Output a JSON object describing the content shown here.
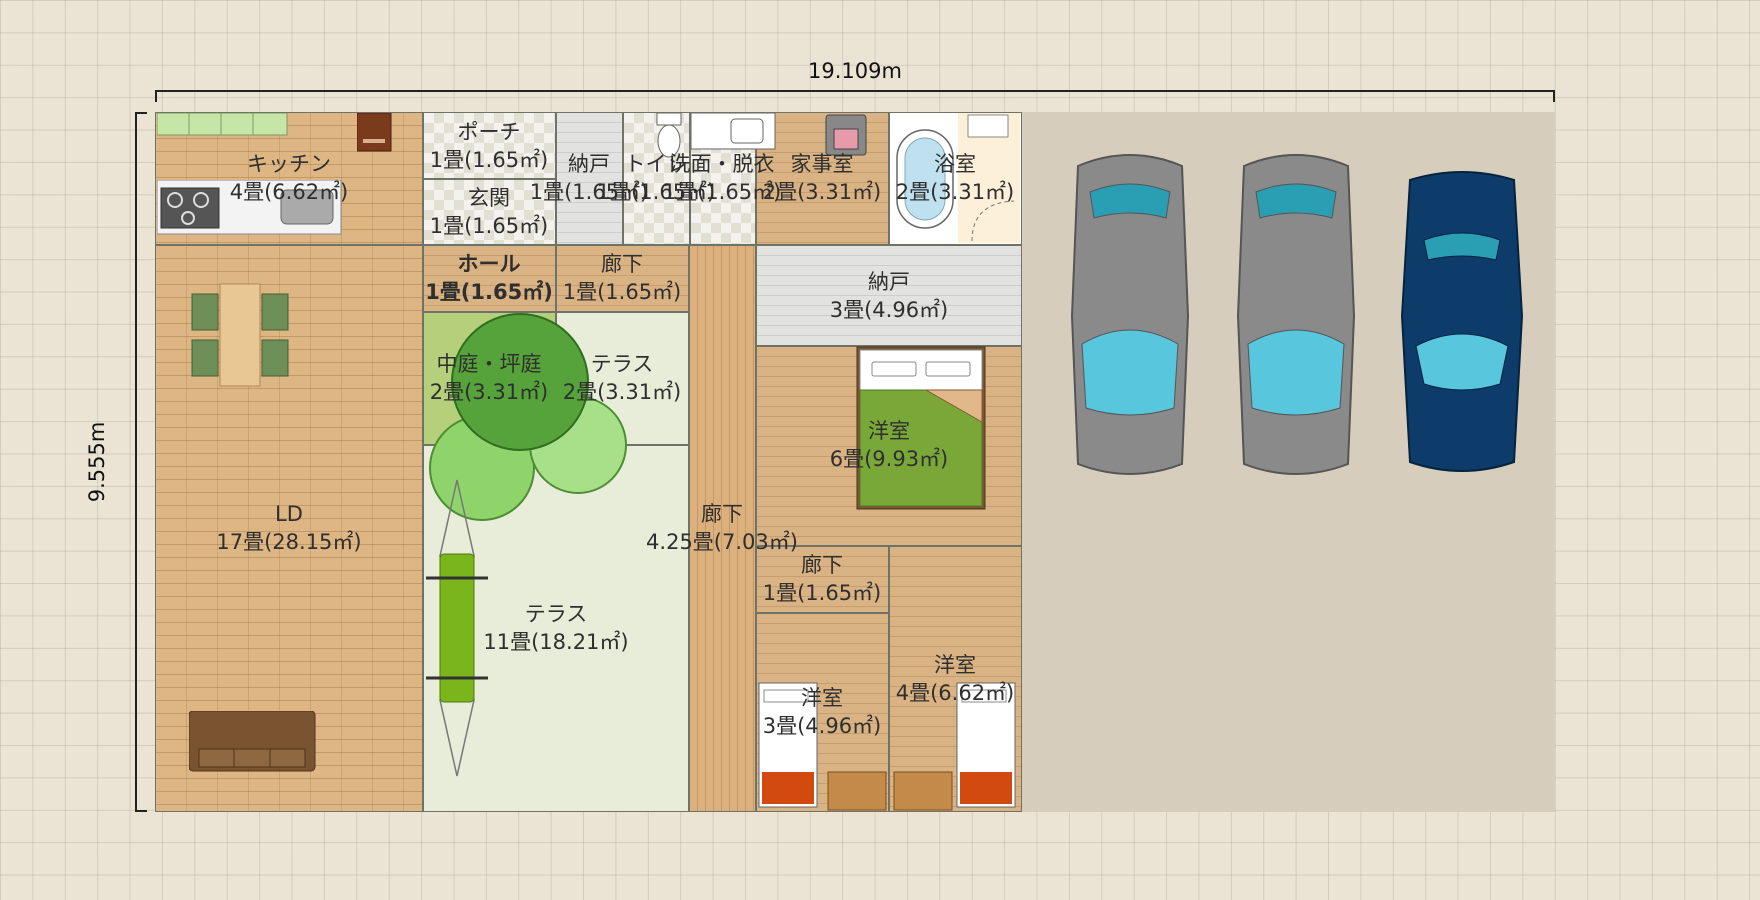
{
  "dimensions": {
    "width": "19.109m",
    "height": "9.555m"
  },
  "rooms": {
    "kitchen": {
      "name": "キッチン",
      "size": "4畳(6.62㎡)"
    },
    "porch": {
      "name": "ポーチ",
      "size": "1畳(1.65㎡)"
    },
    "entrance": {
      "name": "玄関",
      "size": "1畳(1.65㎡)"
    },
    "storage1": {
      "name": "納戸",
      "size": "1畳(1.65㎡)"
    },
    "toilet": {
      "name": "トイレ",
      "size": "1畳(1.65㎡)"
    },
    "washroom": {
      "name": "洗面・脱衣",
      "size": "1畳(1.65㎡)"
    },
    "utility": {
      "name": "家事室",
      "size": "2畳(3.31㎡)"
    },
    "bathroom": {
      "name": "浴室",
      "size": "2畳(3.31㎡)"
    },
    "hall": {
      "name": "ホール",
      "size": "1畳(1.65㎡)"
    },
    "corridor1": {
      "name": "廊下",
      "size": "1畳(1.65㎡)"
    },
    "storage2": {
      "name": "納戸",
      "size": "3畳(4.96㎡)"
    },
    "courtyard": {
      "name": "中庭・坪庭",
      "size": "2畳(3.31㎡)"
    },
    "terrace1": {
      "name": "テラス",
      "size": "2畳(3.31㎡)"
    },
    "western1": {
      "name": "洋室",
      "size": "6畳(9.93㎡)"
    },
    "ld": {
      "name": "LD",
      "size": "17畳(28.15㎡)"
    },
    "corridor2": {
      "name": "廊下",
      "size": "4.25畳(7.03㎡)"
    },
    "corridor3": {
      "name": "廊下",
      "size": "1畳(1.65㎡)"
    },
    "terrace2": {
      "name": "テラス",
      "size": "11畳(18.21㎡)"
    },
    "western2": {
      "name": "洋室",
      "size": "4畳(6.62㎡)"
    },
    "western3": {
      "name": "洋室",
      "size": "3畳(4.96㎡)"
    }
  },
  "colors": {
    "lot": "#d6cdbd",
    "wall": "#6f7266",
    "grid_bg": "#ebe4d5",
    "car_grey": "#8a8a8a",
    "car_blue": "#0d3b6a",
    "glass": "#58c6dc"
  },
  "icons": [
    "car-icon",
    "tree-icon",
    "parasol-icon",
    "bed-icon",
    "sofa-icon",
    "dining-table-icon",
    "bathtub-icon",
    "toilet-icon",
    "sink-icon",
    "stove-icon",
    "washing-machine-icon",
    "chair-icon"
  ]
}
